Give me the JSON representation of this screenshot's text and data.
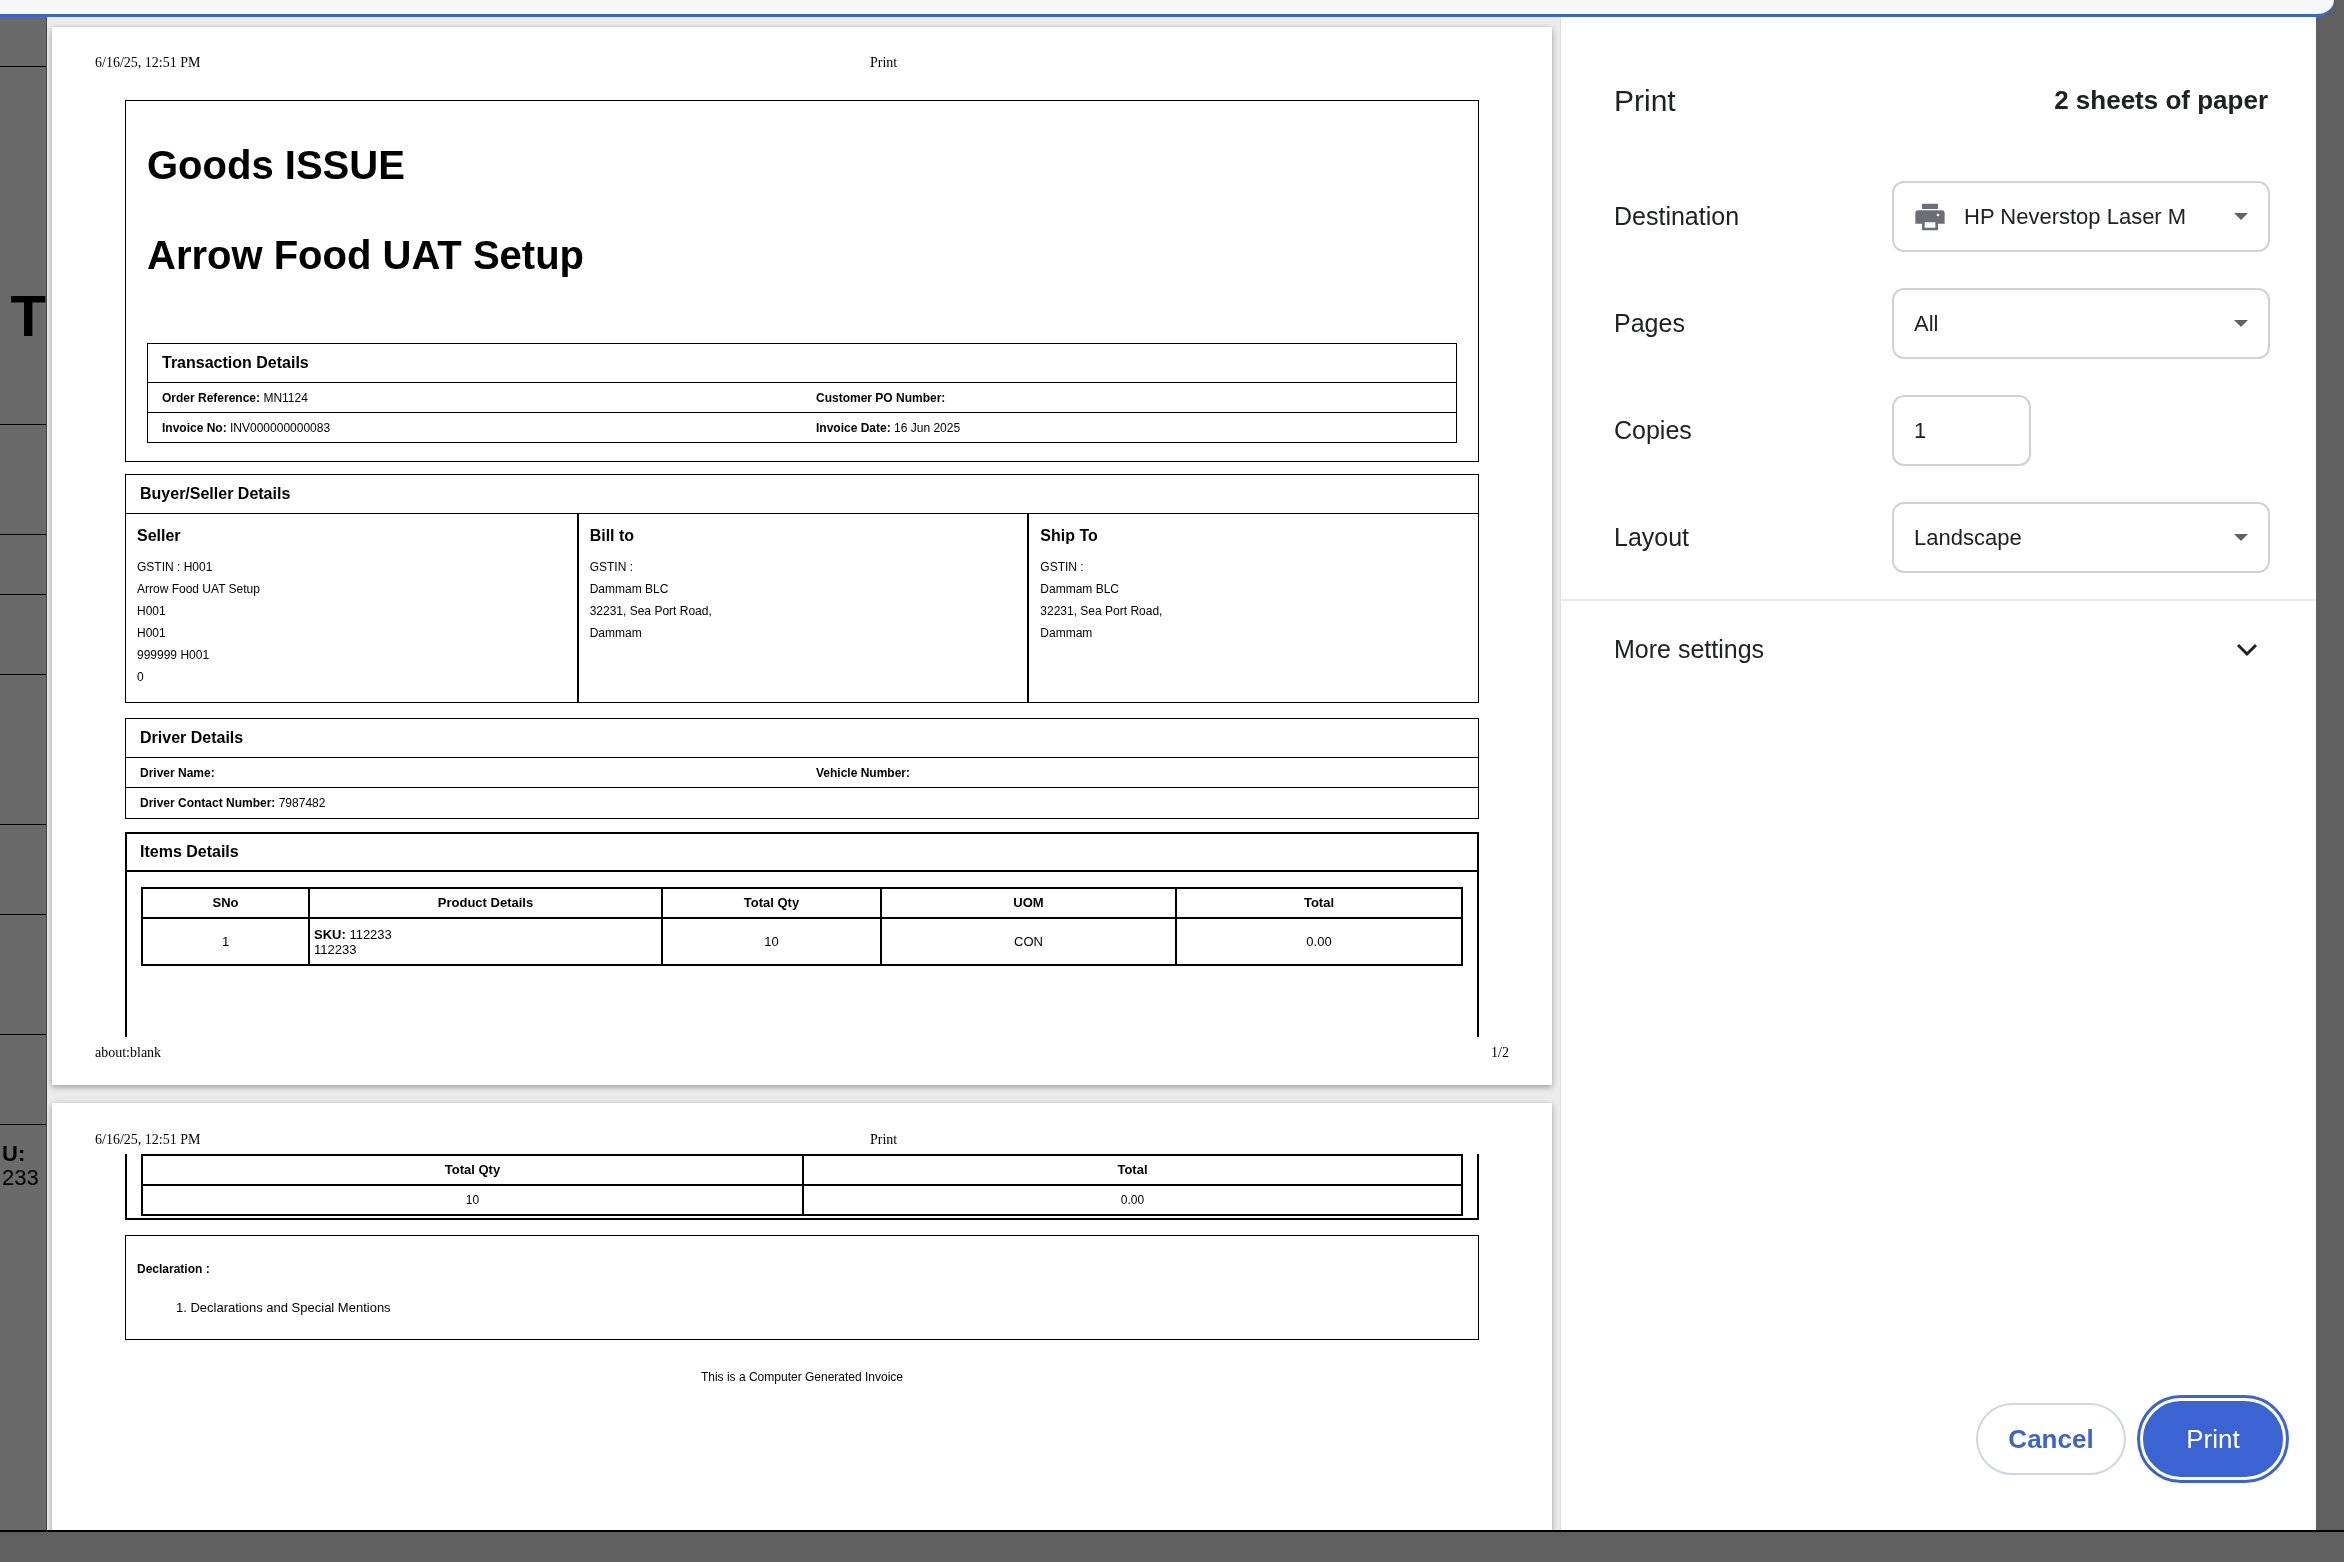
{
  "background_page": {
    "texts": [
      "T",
      "**U:**",
      "233"
    ]
  },
  "page_1": {
    "header_date": "6/16/25, 12:51 PM",
    "header_title": "Print",
    "doc_title": "Goods ISSUE",
    "company": "Arrow Food UAT Setup",
    "transaction": {
      "title": "Transaction Details",
      "fields": [
        {
          "label": "Order Reference:",
          "value": "MN1124"
        },
        {
          "label": "Customer PO Number:"
        },
        {
          "label": "Invoice No:",
          "value": "INV000000000083"
        },
        {
          "label": "Invoice Date:",
          "value": "16 Jun 2025"
        }
      ]
    },
    "buyer_seller": {
      "title": "Buyer/Seller Details",
      "columns": [
        {
          "heading": "Seller",
          "lines": [
            "GSTIN : H001",
            "Arrow Food UAT Setup",
            "H001",
            "H001",
            "999999 H001",
            "0"
          ]
        },
        {
          "heading": "Bill to",
          "lines": [
            "GSTIN :",
            "Dammam BLC",
            "32231, Sea Port Road,",
            "Dammam"
          ]
        },
        {
          "heading": "Ship To",
          "lines": [
            "GSTIN :",
            "Dammam BLC",
            "32231, Sea Port Road,",
            "Dammam"
          ]
        }
      ]
    },
    "driver": {
      "title": "Driver Details",
      "fields": [
        {
          "label": "Driver Name:"
        },
        {
          "label": "Vehicle Number:"
        },
        {
          "label": "Driver Contact Number:",
          "value": "7987482"
        }
      ]
    },
    "items": {
      "title": "Items Details",
      "columns": [
        "SNo",
        "Product Details",
        "Total Qty",
        "UOM",
        "Total"
      ],
      "rows": [
        [
          "1",
          "**SKU:** 112233\n112233",
          "10",
          "CON",
          "0.00"
        ]
      ]
    },
    "footer_url": "about:blank",
    "page_number": "1/2"
  },
  "page_2": {
    "header_date": "6/16/25, 12:51 PM",
    "header_title": "Print",
    "table": {
      "columns": [
        "Total Qty",
        "Total"
      ],
      "rows": [
        [
          "10",
          "0.00"
        ]
      ]
    },
    "declaration": {
      "label": "Declaration :",
      "items": [
        "1. Declarations and Special Mentions"
      ]
    },
    "footer_note": "This is a Computer Generated Invoice"
  },
  "print_panel": {
    "title": "Print",
    "sheets": "2 sheets of paper",
    "settings": [
      {
        "label": "Destination",
        "kind": "destination",
        "value": "HP Neverstop Laser M"
      },
      {
        "label": "Pages",
        "kind": "select",
        "value": "All"
      },
      {
        "label": "Copies",
        "kind": "number",
        "value": "1"
      },
      {
        "label": "Layout",
        "kind": "select",
        "value": "Landscape"
      }
    ],
    "more_settings": {
      "label": "More settings",
      "expanded": false
    },
    "buttons": [
      {
        "label": "Cancel",
        "kind": "secondary"
      },
      {
        "label": "Print",
        "kind": "primary"
      }
    ]
  }
}
